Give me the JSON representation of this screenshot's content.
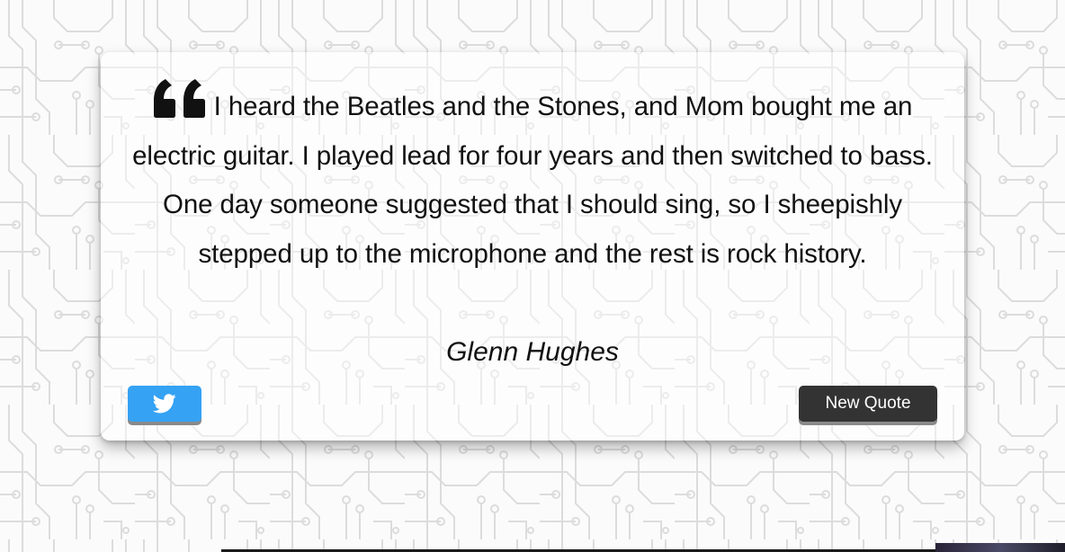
{
  "quote": {
    "text": "I heard the Beatles and the Stones, and Mom bought me an electric guitar. I played lead for four years and then switched to bass. One day someone suggested that I should sing, so I sheepishly stepped up to the microphone and the rest is rock history.",
    "author": "Glenn Hughes",
    "quote_icon": "quote-left-icon"
  },
  "actions": {
    "tweet_icon": "twitter-icon",
    "new_quote_label": "New Quote"
  },
  "colors": {
    "tweet_button": "#35a2f4",
    "new_quote_button": "#333333",
    "text": "#111111"
  }
}
